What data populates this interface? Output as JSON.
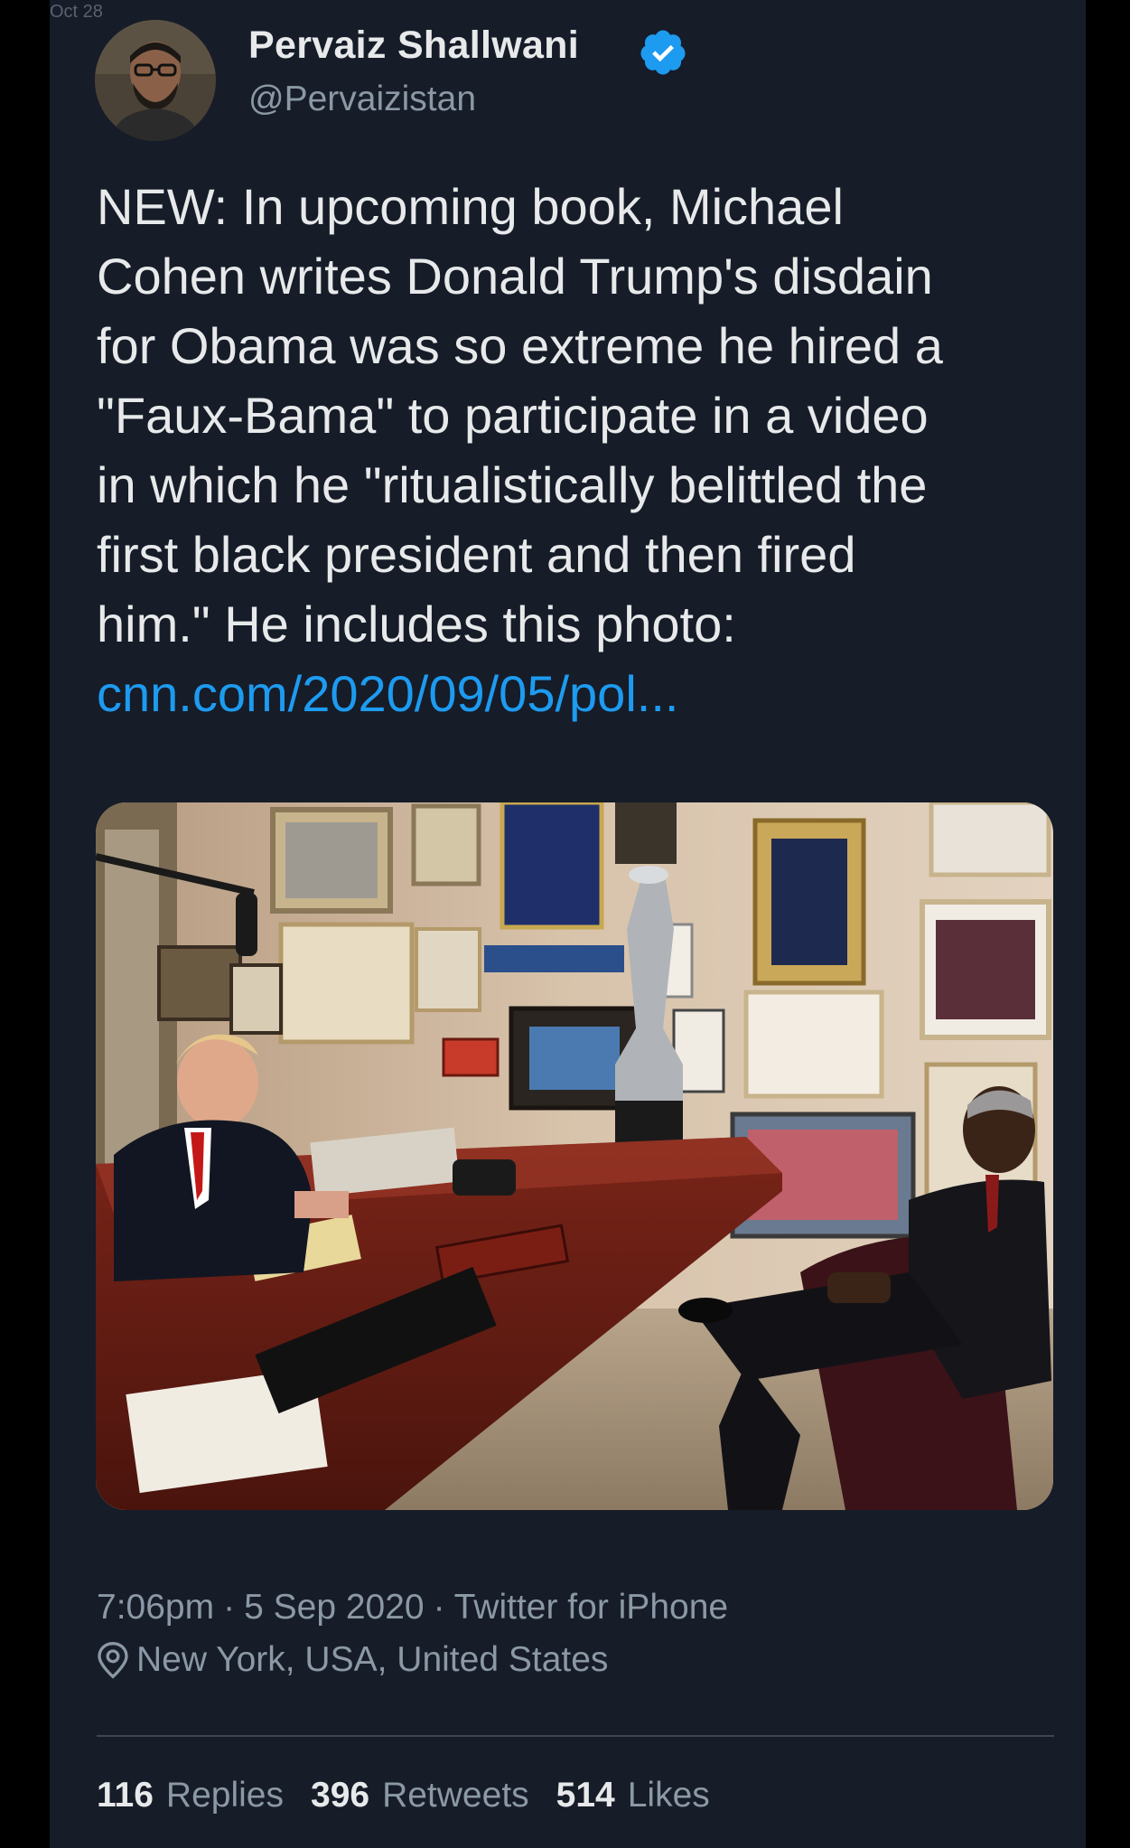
{
  "status_bar": {
    "date": "Oct 28"
  },
  "tweet": {
    "author": {
      "display_name": "Pervaiz Shallwani",
      "handle": "@Pervaizistan",
      "verified": true
    },
    "text": "NEW: In upcoming book, Michael\nCohen writes Donald Trump's disdain\nfor Obama was so extreme he hired a\n\"Faux-Bama\" to participate in a video\nin which he \"ritualistically belittled the\nfirst black president and then fired\nhim.\" He includes this photo:",
    "link": "cnn.com/2020/09/05/pol...",
    "time": "7:06pm",
    "date": "5 Sep 2020",
    "client": "Twitter for iPhone",
    "location": "New York, USA, United States",
    "stats": {
      "replies_count": "116",
      "replies_label": "Replies",
      "retweets_count": "396",
      "retweets_label": "Retweets",
      "likes_count": "514",
      "likes_label": "Likes"
    }
  },
  "colors": {
    "background": "#161c28",
    "text": "#e7e9ea",
    "secondary_text": "#8b98a5",
    "link": "#1d9bf0",
    "verified_badge": "#1d9bf0"
  },
  "icons": {
    "verified": "verified-badge-icon",
    "location": "location-pin-icon"
  }
}
